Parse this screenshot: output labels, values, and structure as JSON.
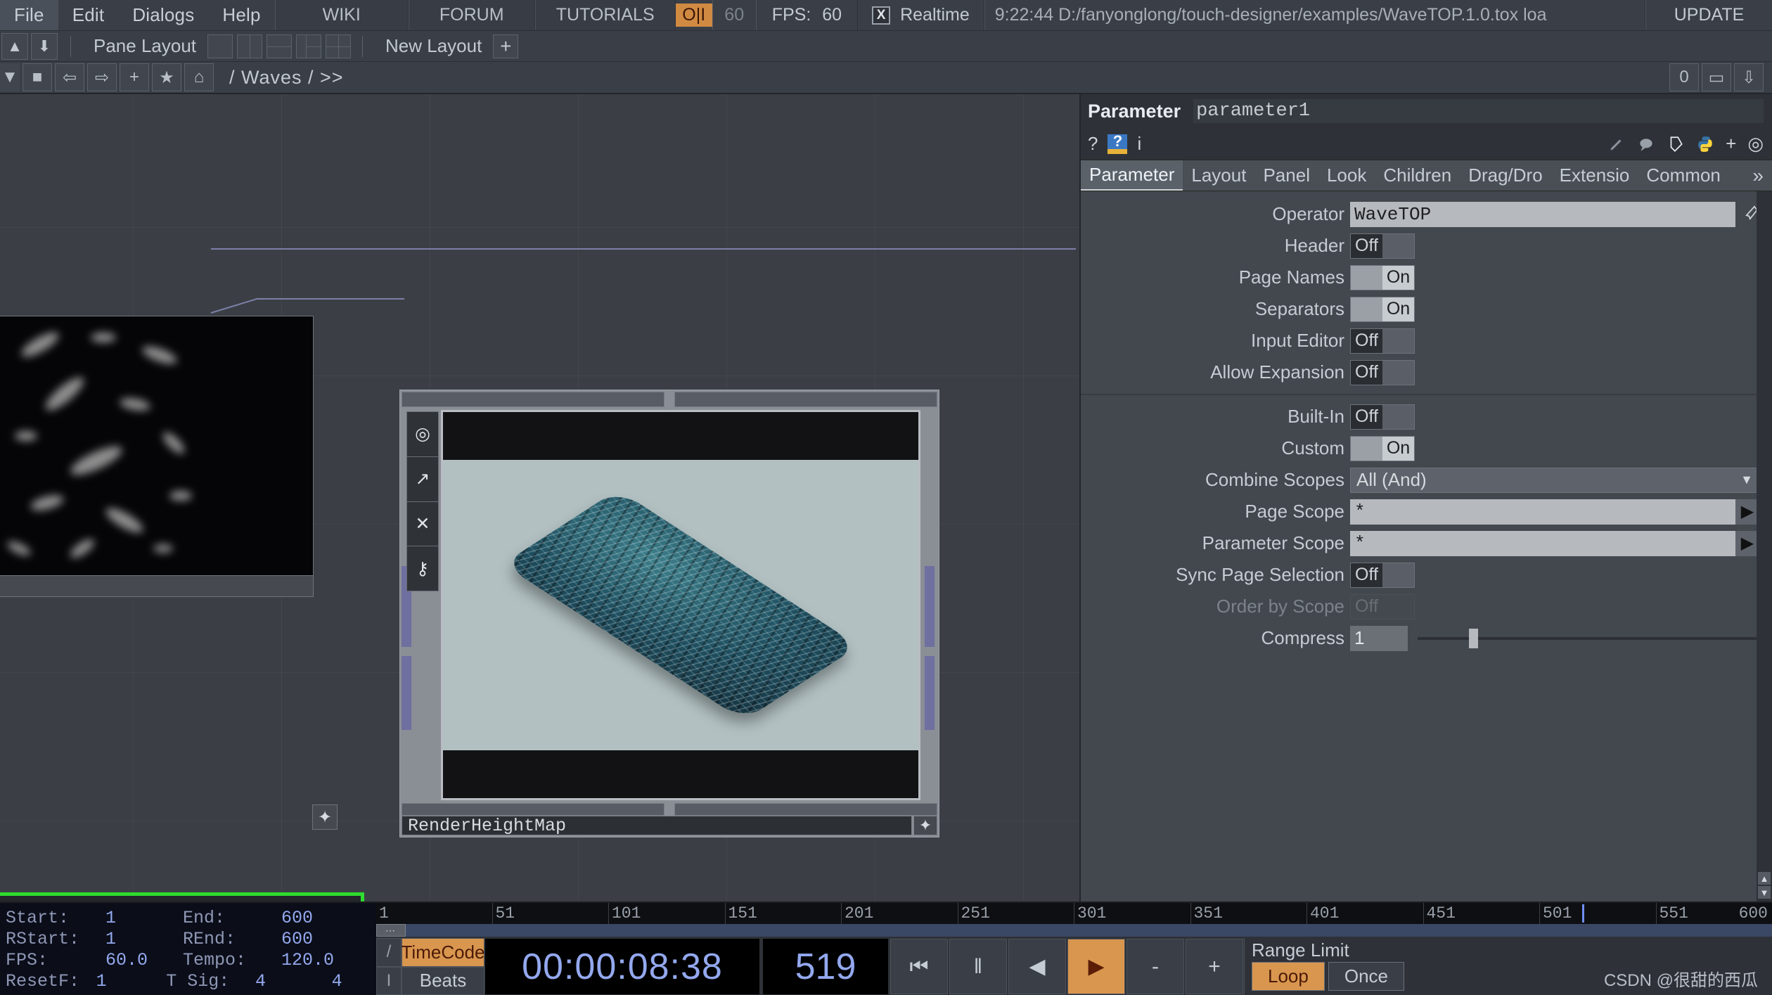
{
  "menubar": {
    "items": [
      "File",
      "Edit",
      "Dialogs",
      "Help"
    ],
    "links": [
      "WIKI",
      "FORUM",
      "TUTORIALS"
    ],
    "oi_label": "O|I",
    "oi_number": "60",
    "fps_label": "FPS:",
    "fps_value": "60",
    "realtime_check": "X",
    "realtime_label": "Realtime",
    "status": "9:22:44 D:/fanyonglong/touch-designer/examples/WaveTOP.1.0.tox loa",
    "update_label": "UPDATE"
  },
  "panebar": {
    "pane_layout_label": "Pane Layout",
    "new_layout_label": "New Layout",
    "plus_label": "+",
    "dropdown_icon": "▲",
    "save_icon": "⬇"
  },
  "crumbbar": {
    "dropdown_icon": "▼",
    "stop_icon": "■",
    "back_icon": "⇦",
    "forward_icon": "⇨",
    "add_icon": "+",
    "star_icon": "★",
    "home_icon": "⌂",
    "path": "/ Waves / >>",
    "right_number": "0",
    "window_icon": "▭",
    "down_icon": "⇩"
  },
  "network": {
    "noise_node_name": "",
    "star_icon": "✦",
    "viewer": {
      "name": "RenderHeightMap",
      "star_icon": "✦",
      "tools": [
        "viewer-target-icon",
        "viewer-bolt-icon",
        "viewer-close-icon",
        "viewer-lock-icon"
      ],
      "tool_glyphs": [
        "◎",
        "↗",
        "✕",
        "⚷"
      ]
    }
  },
  "parameter_panel": {
    "title_label": "Parameter",
    "title_value": "parameter1",
    "icons_left": [
      "?",
      "?",
      "i"
    ],
    "icons_right": [
      "✎",
      "💬",
      "⬠",
      "🐍",
      "+",
      "◎"
    ],
    "tabs": [
      {
        "label": "Parameter",
        "active": true
      },
      {
        "label": "Layout",
        "active": false
      },
      {
        "label": "Panel",
        "active": false
      },
      {
        "label": "Look",
        "active": false
      },
      {
        "label": "Children",
        "active": false
      },
      {
        "label": "Drag/Dro",
        "active": false
      },
      {
        "label": "Extensio",
        "active": false
      },
      {
        "label": "Common",
        "active": false
      }
    ],
    "tabs_more": "»",
    "group1": [
      {
        "label": "Operator",
        "type": "text",
        "value": "WaveTOP"
      },
      {
        "label": "Header",
        "type": "toggle",
        "value": "Off"
      },
      {
        "label": "Page Names",
        "type": "toggle",
        "value": "On"
      },
      {
        "label": "Separators",
        "type": "toggle",
        "value": "On"
      },
      {
        "label": "Input Editor",
        "type": "toggle",
        "value": "Off"
      },
      {
        "label": "Allow Expansion",
        "type": "toggle",
        "value": "Off"
      }
    ],
    "group2": [
      {
        "label": "Built-In",
        "type": "toggle",
        "value": "Off"
      },
      {
        "label": "Custom",
        "type": "toggle",
        "value": "On"
      },
      {
        "label": "Combine Scopes",
        "type": "dropdown",
        "value": "All (And)"
      },
      {
        "label": "Page Scope",
        "type": "text-arrow",
        "value": "*"
      },
      {
        "label": "Parameter Scope",
        "type": "text-arrow",
        "value": "*"
      },
      {
        "label": "Sync Page Selection",
        "type": "toggle",
        "value": "Off"
      },
      {
        "label": "Order by Scope",
        "type": "toggle-disabled",
        "value": "Off"
      },
      {
        "label": "Compress",
        "type": "slider",
        "value": "1"
      }
    ]
  },
  "timeline": {
    "info": [
      {
        "k": "Start:",
        "v": "1",
        "k2": "End:",
        "v2": "600",
        "v3": ""
      },
      {
        "k": "RStart:",
        "v": "1",
        "k2": "REnd:",
        "v2": "600",
        "v3": ""
      },
      {
        "k": "FPS:",
        "v": "60.0",
        "k2": "Tempo:",
        "v2": "120.0",
        "v3": ""
      },
      {
        "k": "ResetF:",
        "v": "1",
        "k2": "T Sig:",
        "v2": "4",
        "v3": "4"
      }
    ],
    "ruler_ticks": [
      "1",
      "51",
      "101",
      "151",
      "201",
      "251",
      "301",
      "351",
      "401",
      "451",
      "501",
      "551"
    ],
    "ruler_end": "600",
    "mode_icons": [
      "/",
      "I"
    ],
    "units": [
      {
        "label": "TimeCode",
        "selected": true
      },
      {
        "label": "Beats",
        "selected": false
      }
    ],
    "timecode": "00:00:08:38",
    "frame": "519",
    "transport": [
      {
        "name": "go-to-start-button",
        "glyph": "⏮",
        "active": false
      },
      {
        "name": "pause-button",
        "glyph": "‖",
        "active": false
      },
      {
        "name": "step-back-button",
        "glyph": "◀",
        "active": false
      },
      {
        "name": "play-button",
        "glyph": "▶",
        "active": true
      },
      {
        "name": "decrement-button",
        "glyph": "-",
        "active": false
      },
      {
        "name": "increment-button",
        "glyph": "+",
        "active": false
      }
    ],
    "range_limit_label": "Range Limit",
    "range_limit_options": [
      {
        "label": "Loop",
        "selected": true
      },
      {
        "label": "Once",
        "selected": false
      }
    ],
    "watermark": "CSDN @很甜的西瓜"
  },
  "colors": {
    "accent_orange": "#d9964f",
    "panel_bg": "#3a3f47",
    "param_bg": "#43474e",
    "text": "#c6ccd3",
    "timecode_blue": "#93a8ee",
    "node_green": "#2fdb2f"
  }
}
